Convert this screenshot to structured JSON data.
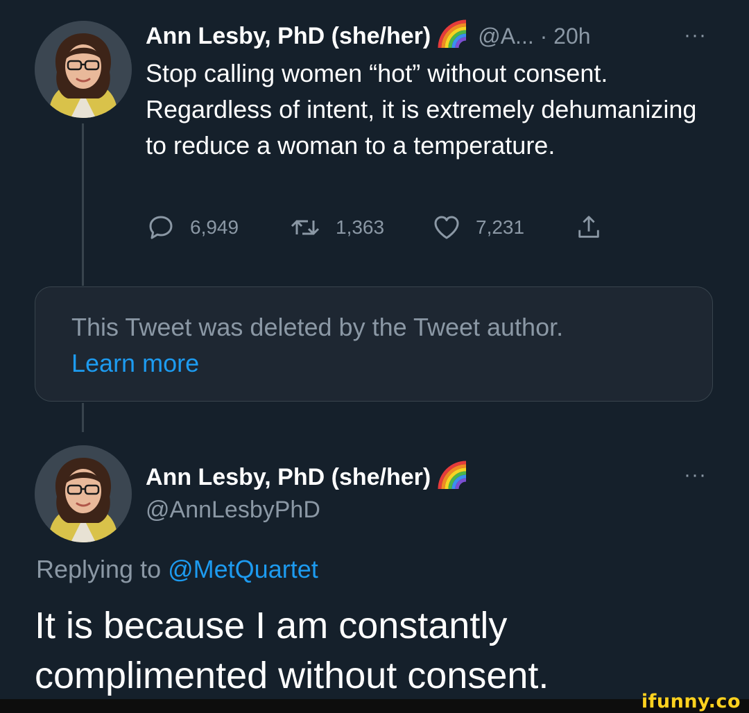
{
  "tweet1": {
    "author_name": "Ann Lesby, PhD (she/her)",
    "author_emoji": "rainbow-emoji",
    "handle_time": "@A... · 20h",
    "more": "···",
    "text": "Stop calling women “hot” without consent. Regardless of intent, it is extremely dehumanizing to reduce a woman to a temperature.",
    "actions": {
      "reply_count": "6,949",
      "retweet_count": "1,363",
      "like_count": "7,231"
    }
  },
  "deleted_notice": {
    "text": "This Tweet was deleted by the Tweet author.",
    "link": "Learn more"
  },
  "tweet2": {
    "author_name": "Ann Lesby, PhD (she/her)",
    "author_emoji": "rainbow-emoji",
    "handle": "@AnnLesbyPhD",
    "more": "···",
    "replying_prefix": "Replying to",
    "replying_to": "@MetQuartet",
    "text": "It is because I am constantly complimented without consent."
  },
  "watermark": {
    "text": "ifunny.co"
  },
  "colors": {
    "background": "#15202b",
    "primary_text": "#ffffff",
    "secondary_text": "#8b98a5",
    "link": "#1d9bf0",
    "border": "#38444d",
    "watermark": "#ffd21f"
  }
}
